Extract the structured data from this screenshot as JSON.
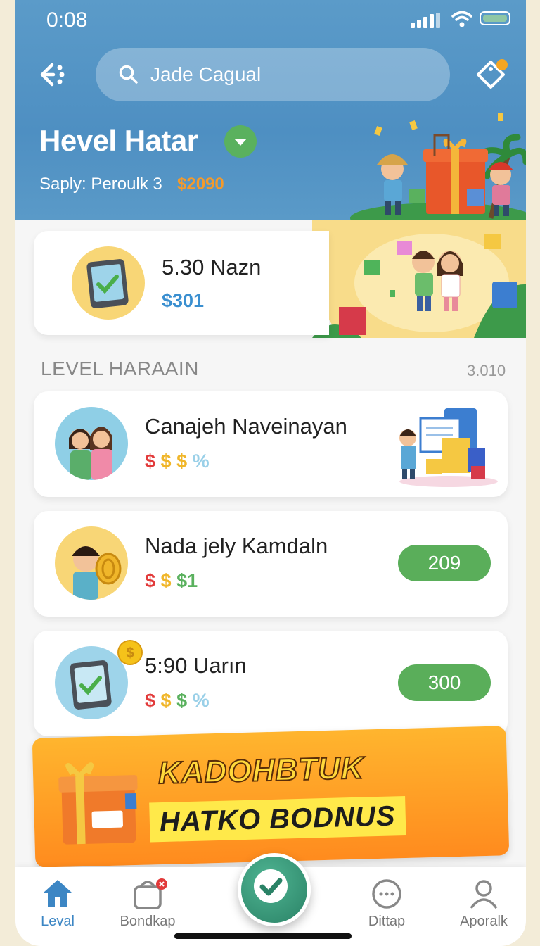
{
  "status": {
    "time": "0:08"
  },
  "search": {
    "value": "Jade Cagual"
  },
  "header": {
    "title": "Hevel Hatar",
    "subtitle": "Saply: Peroulk 3",
    "subtitle_amount": "$2090"
  },
  "summary": {
    "name": "5.30 Nazn",
    "amount": "$301"
  },
  "section": {
    "title": "LEVEL HARAAIN",
    "count": "3.010"
  },
  "rows": [
    {
      "name": "Canajeh Naveinayan",
      "icons": "$ $ $ %"
    },
    {
      "name": "Nada jely Kamdaln",
      "icons": "$ $ $1",
      "value": "209"
    },
    {
      "name": "5:90 Uarın",
      "icons": "$ $ $ %",
      "value": "300"
    }
  ],
  "banner": {
    "line1": "KADOHBTUK",
    "line2": "HATKO BODNUS"
  },
  "tabs": [
    {
      "label": "Leval",
      "icon": "home-icon",
      "active": true
    },
    {
      "label": "Bondkap",
      "icon": "bag-icon",
      "active": false
    },
    {
      "label": "Dittap",
      "icon": "chat-icon",
      "active": false
    },
    {
      "label": "Aporalk",
      "icon": "user-icon",
      "active": false
    }
  ],
  "colors": {
    "header": "#4e8fc2",
    "accent_green": "#5aae5a",
    "banner_orange": "#ff8b1e",
    "amount_orange": "#f39a2c",
    "amount_blue": "#3a8fd0"
  }
}
